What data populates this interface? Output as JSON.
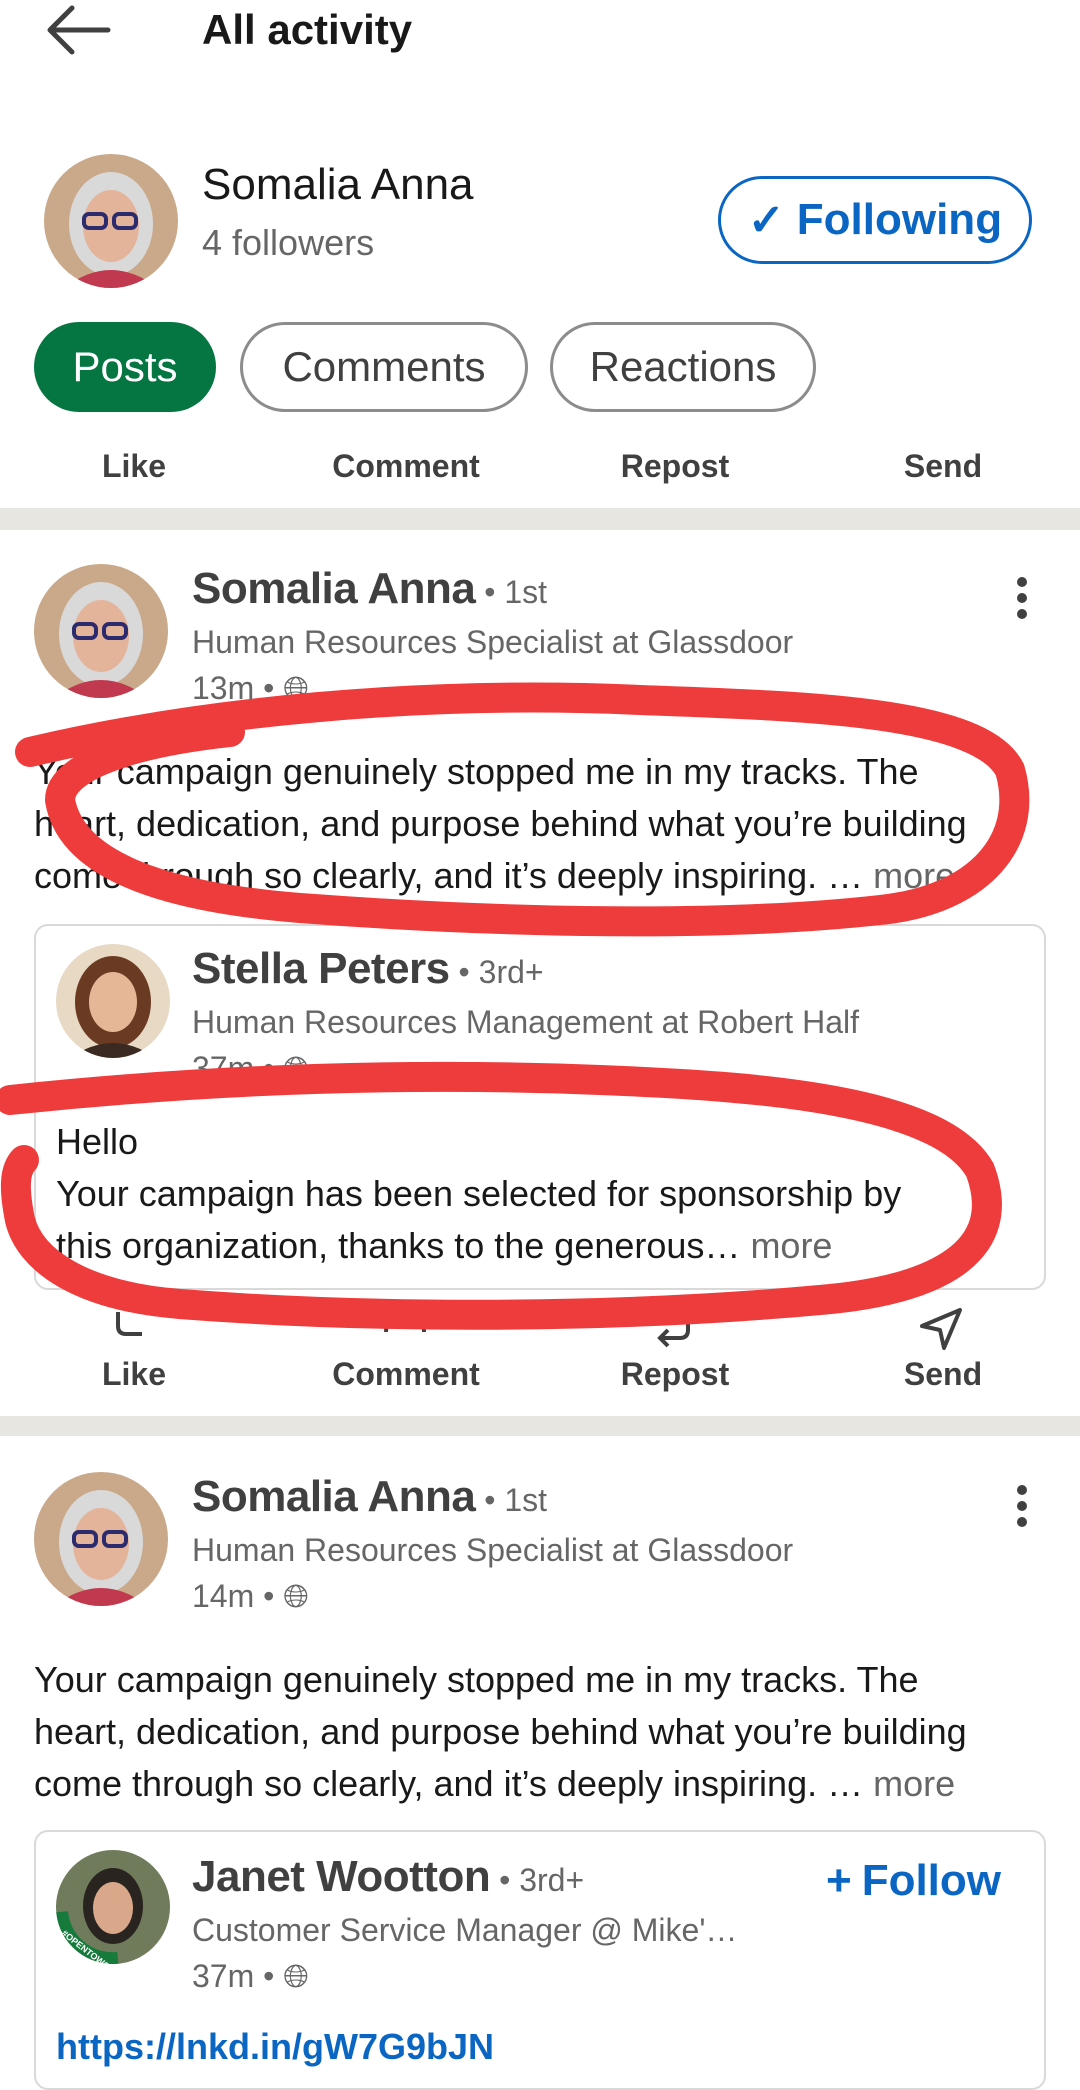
{
  "header": {
    "title": "All activity"
  },
  "profile": {
    "name": "Somalia Anna",
    "followers": "4 followers",
    "following_label": "Following"
  },
  "filters": [
    {
      "label": "Posts",
      "active": true
    },
    {
      "label": "Comments",
      "active": false
    },
    {
      "label": "Reactions",
      "active": false
    }
  ],
  "actions": {
    "like": "Like",
    "comment": "Comment",
    "repost": "Repost",
    "send": "Send"
  },
  "posts": [
    {
      "author": "Somalia Anna",
      "degree": "1st",
      "headline": "Human Resources Specialist at Glassdoor",
      "time": "13m",
      "lines": [
        "Your campaign genuinely stopped me in my tracks. The",
        "heart, dedication, and purpose behind what you’re building",
        "come through so clearly, and it’s deeply inspiring. … "
      ],
      "more": "more",
      "shared": {
        "author": "Stella Peters",
        "degree": "3rd+",
        "headline": "Human Resources Management at Robert Half",
        "time": "37m",
        "lines": [
          "Hello",
          "Your campaign has been selected for sponsorship by",
          "this organization, thanks to the generous… "
        ],
        "more": "more"
      }
    },
    {
      "author": "Somalia Anna",
      "degree": "1st",
      "headline": "Human Resources Specialist at Glassdoor",
      "time": "14m",
      "lines": [
        "Your campaign genuinely stopped me in my tracks. The",
        "heart, dedication, and purpose behind what you’re building",
        "come through so clearly, and it’s deeply inspiring. … "
      ],
      "more": "more",
      "shared": {
        "author": "Janet Wootton",
        "degree": "3rd+",
        "headline": "Customer Service Manager @ Mike'…",
        "time": "37m",
        "follow_label": "Follow",
        "link": "https://lnkd.in/gW7G9bJN",
        "badge": "#OPENTOWORK"
      }
    }
  ],
  "colors": {
    "accent": "#0a66c2",
    "active_pill": "#057642",
    "annotation": "#ee3b3b"
  }
}
